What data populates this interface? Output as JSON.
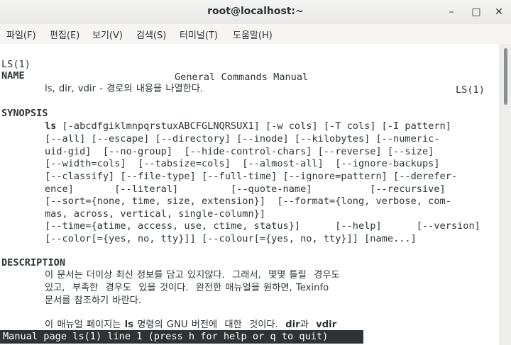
{
  "window": {
    "title": "root@localhost:~",
    "minimize": "–",
    "maximize": "□",
    "close": "✕"
  },
  "menu": [
    "파일(F)",
    "편집(E)",
    "보기(V)",
    "검색(S)",
    "터미널(T)",
    "도움말(H)"
  ],
  "man": {
    "header_left": "LS(1)",
    "header_center": "General Commands Manual",
    "header_right": "LS(1)",
    "name_heading": "NAME",
    "name_line": "ls, dir, vdir - 경로의 내용을 나열한다.",
    "synopsis_heading": "SYNOPSIS",
    "synopsis_cmd": "ls",
    "synopsis": [
      " [-abcdfgiklmnpqrstuxABCFGLNQRSUX1] [-w cols] [-T cols] [-I pattern]",
      "[--all] [--escape] [--directory] [--inode] [--kilobytes] [--numeric-",
      "uid-gid]  [--no-group]  [--hide-control-chars] [--reverse] [--size]",
      "[--width=cols]  [--tabsize=cols]  [--almost-all]  [--ignore-backups]",
      "[--classify] [--file-type] [--full-time] [--ignore=pattern] [--derefer-",
      "ence]       [--literal]         [--quote-name]          [--recursive]",
      "[--sort={none, time, size, extension}]  [--format={long, verbose, com-",
      "mas, across, vertical, single-column}]",
      "[--time={atime, access, use, ctime, status}]      [--help]      [--version]",
      "[--color[={yes, no, tty}]] [--colour[={yes, no, tty}]] [name...]"
    ],
    "description_heading": "DESCRIPTION",
    "description": [
      "이 문서는 더이상 최신 정보를 담고 있지않다.  그래서,  몇몇 틀릴  경우도",
      "있고,  부족한  경우도  있을 것이다.  완전한 매뉴얼을 원하면, Texinfo",
      "문서를 참조하기 바란다."
    ],
    "last_line_start": "이 매뉴얼 페이지는 ",
    "last_line_ls": "ls",
    "last_line_mid": " 명령의 GNU 버전에  대한  것이다.  ",
    "last_line_dir": "dir",
    "last_line_and": "과  ",
    "last_line_vdir": "vdir"
  },
  "status_text": "Manual page ls(1) line 1 (press h for help or q to quit)"
}
